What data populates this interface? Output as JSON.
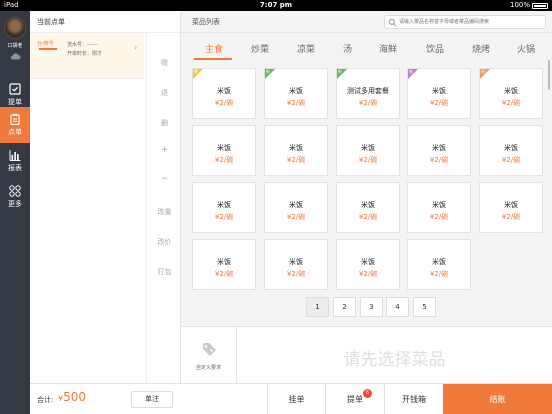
{
  "status_bar": {
    "carrier": "iPad",
    "time": "7:07 pm",
    "battery": "100%"
  },
  "nav": {
    "shop_name": "口袋老",
    "items": [
      {
        "label": "提单"
      },
      {
        "label": "点单"
      },
      {
        "label": "报表"
      },
      {
        "label": "更多"
      }
    ]
  },
  "order": {
    "header": "当前点单",
    "table_name": "台/牌号",
    "flow_no": "流水号：------",
    "open_time": "开单时长：刚才",
    "actions": [
      "赠",
      "退",
      "删",
      "+",
      "−",
      "改量",
      "改价",
      "打包"
    ]
  },
  "menu": {
    "title": "菜品列表",
    "search_placeholder": "请输入菜品名称首字母或者菜品编码搜索",
    "categories": [
      "主食",
      "炒菜",
      "凉菜",
      "汤",
      "海鲜",
      "饮品",
      "烧烤",
      "火锅"
    ],
    "active_category": "主食",
    "dishes": [
      {
        "name": "米饭",
        "price": "¥2/碗",
        "tag": "赠",
        "tag_color": "#f5c531"
      },
      {
        "name": "米饭",
        "price": "¥2/碗",
        "tag": "新",
        "tag_color": "#5fb860"
      },
      {
        "name": "测试多用套餐",
        "price": "¥2/碗",
        "tag": "新",
        "tag_color": "#5fb860"
      },
      {
        "name": "米饭",
        "price": "¥2/碗",
        "tag": "推",
        "tag_color": "#b880c8"
      },
      {
        "name": "米饭",
        "price": "¥2/碗",
        "tag": "招",
        "tag_color": "#e0a060"
      },
      {
        "name": "米饭",
        "price": "¥2/碗"
      },
      {
        "name": "米饭",
        "price": "¥2/碗"
      },
      {
        "name": "米饭",
        "price": "¥2/碗"
      },
      {
        "name": "米饭",
        "price": "¥2/碗"
      },
      {
        "name": "米饭",
        "price": "¥2/碗"
      },
      {
        "name": "米饭",
        "price": "¥2/碗"
      },
      {
        "name": "米饭",
        "price": "¥2/碗"
      },
      {
        "name": "米饭",
        "price": "¥2/碗"
      },
      {
        "name": "米饭",
        "price": "¥2/碗"
      },
      {
        "name": "米饭",
        "price": "¥2/碗"
      },
      {
        "name": "米饭",
        "price": "¥2/碗"
      },
      {
        "name": "米饭",
        "price": "¥2/碗"
      },
      {
        "name": "米饭",
        "price": "¥2/碗"
      },
      {
        "name": "米饭",
        "price": "¥2/碗"
      }
    ],
    "pages": [
      "1",
      "2",
      "3",
      "4",
      "5"
    ],
    "current_page": "1",
    "custom_request": "自定义要求",
    "empty_hint": "请先选择菜品"
  },
  "bottom": {
    "total_label": "合计:",
    "currency": "¥",
    "total_amount": "500",
    "note_button": "单注",
    "hang_button": "挂单",
    "pickup_button": "提单",
    "pickup_badge": "6",
    "cashbox_button": "开钱箱",
    "checkout_button": "结账"
  },
  "colors": {
    "accent": "#f07a3c",
    "nav_bg": "#333a44"
  }
}
